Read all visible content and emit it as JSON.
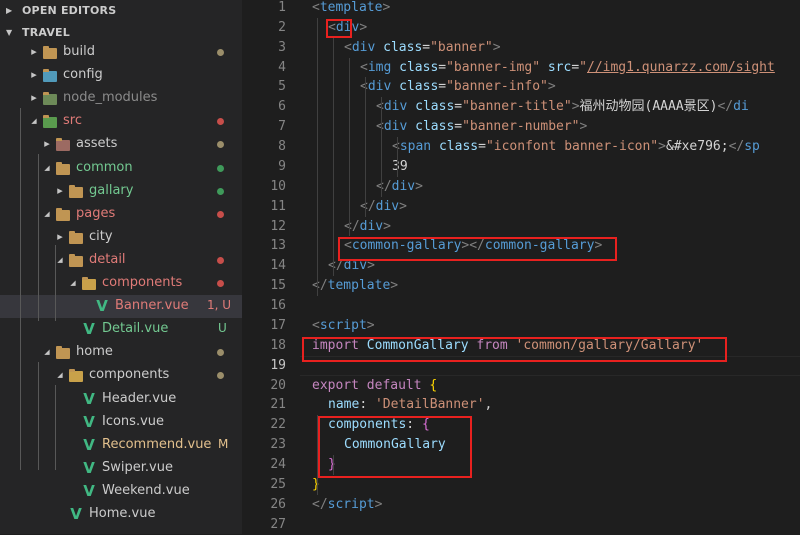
{
  "sidebar": {
    "open_editors": "OPEN EDITORS",
    "project": "TRAVEL",
    "tree": [
      {
        "label": "build",
        "kind": "folder",
        "depth": 1,
        "expanded": false,
        "color": "#cccccc",
        "dot": "#9b8e6a",
        "status": ""
      },
      {
        "label": "config",
        "kind": "folder-config",
        "depth": 1,
        "expanded": false,
        "color": "#cccccc",
        "dot": "",
        "status": ""
      },
      {
        "label": "node_modules",
        "kind": "folder-node",
        "depth": 1,
        "expanded": false,
        "color": "#8b8b8b",
        "dot": "",
        "status": ""
      },
      {
        "label": "src",
        "kind": "folder-src",
        "depth": 1,
        "expanded": true,
        "color": "#e07b78",
        "dot": "#c74e4a",
        "status": ""
      },
      {
        "label": "assets",
        "kind": "folder-assets",
        "depth": 2,
        "expanded": false,
        "color": "#cccccc",
        "dot": "#9b8e6a",
        "status": ""
      },
      {
        "label": "common",
        "kind": "folder",
        "depth": 2,
        "expanded": true,
        "color": "#73c991",
        "dot": "#3f9a5a",
        "status": ""
      },
      {
        "label": "gallary",
        "kind": "folder",
        "depth": 3,
        "expanded": false,
        "color": "#73c991",
        "dot": "#3f9a5a",
        "status": ""
      },
      {
        "label": "pages",
        "kind": "folder",
        "depth": 2,
        "expanded": true,
        "color": "#e07b78",
        "dot": "#c74e4a",
        "status": ""
      },
      {
        "label": "city",
        "kind": "folder",
        "depth": 3,
        "expanded": false,
        "color": "#cccccc",
        "dot": "",
        "status": ""
      },
      {
        "label": "detail",
        "kind": "folder",
        "depth": 3,
        "expanded": true,
        "color": "#e07b78",
        "dot": "#c74e4a",
        "status": ""
      },
      {
        "label": "components",
        "kind": "folder-components",
        "depth": 4,
        "expanded": true,
        "color": "#e07b78",
        "dot": "#c74e4a",
        "status": ""
      },
      {
        "label": "Banner.vue",
        "kind": "vue",
        "depth": 5,
        "expanded": null,
        "color": "#e07b78",
        "dot": "",
        "status": "1, U",
        "status_color": "#e07b78",
        "selected": true
      },
      {
        "label": "Detail.vue",
        "kind": "vue",
        "depth": 4,
        "expanded": null,
        "color": "#73c991",
        "dot": "",
        "status": "U",
        "status_color": "#73c991"
      },
      {
        "label": "home",
        "kind": "folder",
        "depth": 2,
        "expanded": true,
        "color": "#cccccc",
        "dot": "#9b8e6a",
        "status": ""
      },
      {
        "label": "components",
        "kind": "folder-components",
        "depth": 3,
        "expanded": true,
        "color": "#cccccc",
        "dot": "#9b8e6a",
        "status": ""
      },
      {
        "label": "Header.vue",
        "kind": "vue",
        "depth": 4,
        "expanded": null,
        "color": "#cccccc",
        "dot": "",
        "status": ""
      },
      {
        "label": "Icons.vue",
        "kind": "vue",
        "depth": 4,
        "expanded": null,
        "color": "#cccccc",
        "dot": "",
        "status": ""
      },
      {
        "label": "Recommend.vue",
        "kind": "vue",
        "depth": 4,
        "expanded": null,
        "color": "#e2c08d",
        "dot": "",
        "status": "M",
        "status_color": "#e2c08d"
      },
      {
        "label": "Swiper.vue",
        "kind": "vue",
        "depth": 4,
        "expanded": null,
        "color": "#cccccc",
        "dot": "",
        "status": ""
      },
      {
        "label": "Weekend.vue",
        "kind": "vue",
        "depth": 4,
        "expanded": null,
        "color": "#cccccc",
        "dot": "",
        "status": ""
      },
      {
        "label": "Home.vue",
        "kind": "vue",
        "depth": 3,
        "expanded": null,
        "color": "#cccccc",
        "dot": "",
        "status": ""
      }
    ]
  },
  "editor": {
    "active_line": 19,
    "lines": [
      {
        "n": 1,
        "indent": 0,
        "tokens": [
          [
            "t-br",
            "<"
          ],
          [
            "t-tag",
            "template"
          ],
          [
            "t-br",
            ">"
          ]
        ]
      },
      {
        "n": 2,
        "indent": 1,
        "tokens": [
          [
            "t-br",
            "<"
          ],
          [
            "t-tag",
            "div"
          ],
          [
            "t-br",
            ">"
          ]
        ]
      },
      {
        "n": 3,
        "indent": 2,
        "tokens": [
          [
            "t-br",
            "<"
          ],
          [
            "t-tag",
            "div "
          ],
          [
            "t-attr",
            "class"
          ],
          [
            "t-text",
            "="
          ],
          [
            "t-str",
            "\"banner\""
          ],
          [
            "t-br",
            ">"
          ]
        ]
      },
      {
        "n": 4,
        "indent": 3,
        "tokens": [
          [
            "t-br",
            "<"
          ],
          [
            "t-tag",
            "img "
          ],
          [
            "t-attr",
            "class"
          ],
          [
            "t-text",
            "="
          ],
          [
            "t-str",
            "\"banner-img\" "
          ],
          [
            "t-attr",
            "src"
          ],
          [
            "t-text",
            "="
          ],
          [
            "t-str",
            "\""
          ],
          [
            "t-link",
            "//img1.qunarzz.com/sight"
          ]
        ]
      },
      {
        "n": 5,
        "indent": 3,
        "tokens": [
          [
            "t-br",
            "<"
          ],
          [
            "t-tag",
            "div "
          ],
          [
            "t-attr",
            "class"
          ],
          [
            "t-text",
            "="
          ],
          [
            "t-str",
            "\"banner-info\""
          ],
          [
            "t-br",
            ">"
          ]
        ]
      },
      {
        "n": 6,
        "indent": 4,
        "tokens": [
          [
            "t-br",
            "<"
          ],
          [
            "t-tag",
            "div "
          ],
          [
            "t-attr",
            "class"
          ],
          [
            "t-text",
            "="
          ],
          [
            "t-str",
            "\"banner-title\""
          ],
          [
            "t-br",
            ">"
          ],
          [
            "t-text",
            "福州动物园(AAAA景区)"
          ],
          [
            "t-br",
            "</"
          ],
          [
            "t-tag",
            "di"
          ]
        ]
      },
      {
        "n": 7,
        "indent": 4,
        "tokens": [
          [
            "t-br",
            "<"
          ],
          [
            "t-tag",
            "div "
          ],
          [
            "t-attr",
            "class"
          ],
          [
            "t-text",
            "="
          ],
          [
            "t-str",
            "\"banner-number\""
          ],
          [
            "t-br",
            ">"
          ]
        ]
      },
      {
        "n": 8,
        "indent": 5,
        "tokens": [
          [
            "t-br",
            "<"
          ],
          [
            "t-tag",
            "span "
          ],
          [
            "t-attr",
            "class"
          ],
          [
            "t-text",
            "="
          ],
          [
            "t-str",
            "\"iconfont banner-icon\""
          ],
          [
            "t-br",
            ">"
          ],
          [
            "t-text",
            "&#xe796;"
          ],
          [
            "t-br",
            "</"
          ],
          [
            "t-tag",
            "sp"
          ]
        ]
      },
      {
        "n": 9,
        "indent": 5,
        "tokens": [
          [
            "t-text",
            "39"
          ]
        ]
      },
      {
        "n": 10,
        "indent": 4,
        "tokens": [
          [
            "t-br",
            "</"
          ],
          [
            "t-tag",
            "div"
          ],
          [
            "t-br",
            ">"
          ]
        ]
      },
      {
        "n": 11,
        "indent": 3,
        "tokens": [
          [
            "t-br",
            "</"
          ],
          [
            "t-tag",
            "div"
          ],
          [
            "t-br",
            ">"
          ]
        ]
      },
      {
        "n": 12,
        "indent": 2,
        "tokens": [
          [
            "t-br",
            "</"
          ],
          [
            "t-tag",
            "div"
          ],
          [
            "t-br",
            ">"
          ]
        ]
      },
      {
        "n": 13,
        "indent": 2,
        "tokens": [
          [
            "t-br",
            "<"
          ],
          [
            "t-tag",
            "common-gallary"
          ],
          [
            "t-br",
            "></"
          ],
          [
            "t-tag",
            "common-gallary"
          ],
          [
            "t-br",
            ">"
          ]
        ]
      },
      {
        "n": 14,
        "indent": 1,
        "tokens": [
          [
            "t-br",
            "</"
          ],
          [
            "t-tag",
            "div"
          ],
          [
            "t-br",
            ">"
          ]
        ]
      },
      {
        "n": 15,
        "indent": 0,
        "tokens": [
          [
            "t-br",
            "</"
          ],
          [
            "t-tag",
            "template"
          ],
          [
            "t-br",
            ">"
          ]
        ]
      },
      {
        "n": 16,
        "indent": 0,
        "tokens": []
      },
      {
        "n": 17,
        "indent": 0,
        "tokens": [
          [
            "t-br",
            "<"
          ],
          [
            "t-tag",
            "script"
          ],
          [
            "t-br",
            ">"
          ]
        ]
      },
      {
        "n": 18,
        "indent": 0,
        "tokens": [
          [
            "t-kw",
            "import "
          ],
          [
            "t-var",
            "CommonGallary "
          ],
          [
            "t-kw",
            "from "
          ],
          [
            "t-str",
            "'common/gallary/Gallary'"
          ]
        ]
      },
      {
        "n": 19,
        "indent": 0,
        "tokens": []
      },
      {
        "n": 20,
        "indent": 0,
        "tokens": [
          [
            "t-kw",
            "export "
          ],
          [
            "t-kw",
            "default "
          ],
          [
            "t-br3",
            "{"
          ]
        ]
      },
      {
        "n": 21,
        "indent": 1,
        "tokens": [
          [
            "t-prop",
            "name"
          ],
          [
            "t-pun",
            ": "
          ],
          [
            "t-str",
            "'DetailBanner'"
          ],
          [
            "t-pun",
            ","
          ]
        ]
      },
      {
        "n": 22,
        "indent": 1,
        "tokens": [
          [
            "t-prop",
            "components"
          ],
          [
            "t-pun",
            ": "
          ],
          [
            "t-br2",
            "{"
          ]
        ]
      },
      {
        "n": 23,
        "indent": 2,
        "tokens": [
          [
            "t-var",
            "CommonGallary"
          ]
        ]
      },
      {
        "n": 24,
        "indent": 1,
        "tokens": [
          [
            "t-br2",
            "}"
          ]
        ]
      },
      {
        "n": 25,
        "indent": 0,
        "tokens": [
          [
            "t-br3",
            "}"
          ]
        ]
      },
      {
        "n": 26,
        "indent": 0,
        "tokens": [
          [
            "t-br",
            "</"
          ],
          [
            "t-tag",
            "script"
          ],
          [
            "t-br",
            ">"
          ]
        ]
      },
      {
        "n": 27,
        "indent": 0,
        "tokens": []
      }
    ]
  }
}
